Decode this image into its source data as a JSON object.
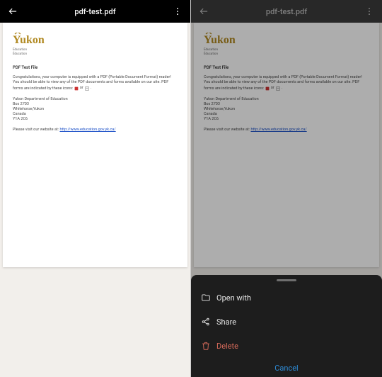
{
  "left": {
    "appbar": {
      "title": "pdf-test.pdf"
    },
    "pdf": {
      "logo_text": "Yukon",
      "logo_sub1": "Education",
      "logo_sub2": "Éducation",
      "title": "PDF Test File",
      "para": "Congratulations, your computer is equipped with a PDF (Portable Document Format) reader!  You should be able to view any of the PDF documents and forms available on our site.  PDF forms are indicated by these icons:",
      "or": "or",
      "addr": {
        "l1": "Yukon Department of Education",
        "l2": "Box 2703",
        "l3": "Whitehorse,Yukon",
        "l4": "Canada",
        "l5": "Y1A 2C6"
      },
      "visit_prefix": "Please visit our website at:  ",
      "link": "http://www.education.gov.yk.ca/"
    }
  },
  "right": {
    "appbar": {
      "title": "pdf-test.pdf"
    },
    "sheet": {
      "open": "Open with",
      "share": "Share",
      "delete": "Delete",
      "cancel": "Cancel"
    }
  }
}
